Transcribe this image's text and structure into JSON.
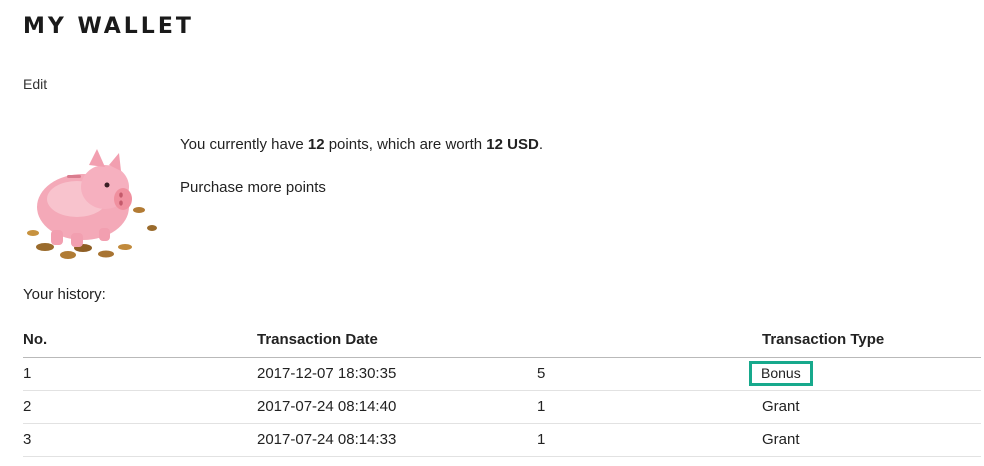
{
  "page": {
    "title": "MY WALLET",
    "edit_label": "Edit"
  },
  "wallet": {
    "balance_prefix": "You currently have ",
    "points": "12",
    "balance_middle": " points, which are worth ",
    "worth": "12 USD",
    "balance_suffix": ".",
    "purchase_label": "Purchase more points",
    "image_icon": "piggy-bank-icon"
  },
  "history": {
    "label": "Your history:",
    "columns": [
      "No.",
      "Transaction Date",
      "",
      "Transaction Type"
    ],
    "rows": [
      {
        "no": "1",
        "date": "2017-12-07 18:30:35",
        "amount": "5",
        "type": "Bonus"
      },
      {
        "no": "2",
        "date": "2017-07-24 08:14:40",
        "amount": "1",
        "type": "Grant"
      },
      {
        "no": "3",
        "date": "2017-07-24 08:14:33",
        "amount": "1",
        "type": "Grant"
      }
    ]
  },
  "colors": {
    "highlight": "#17a98c",
    "piggy": "#f4a9b8"
  }
}
